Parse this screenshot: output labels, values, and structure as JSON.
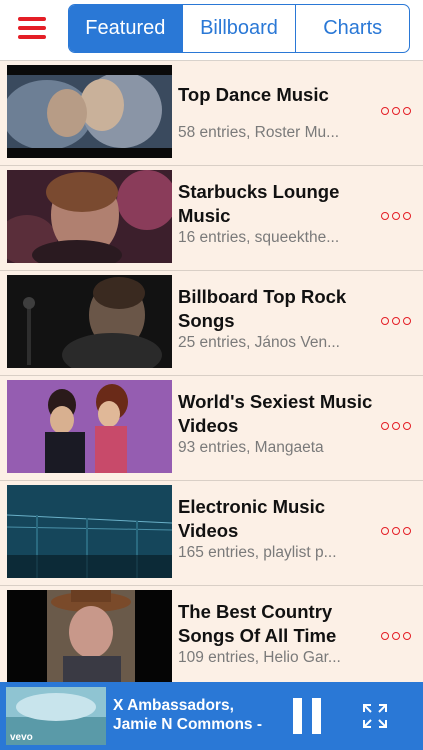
{
  "nav": {
    "menu_icon": "hamburger-icon",
    "tabs": [
      {
        "label": "Featured",
        "active": true
      },
      {
        "label": "Billboard",
        "active": false
      },
      {
        "label": "Charts",
        "active": false
      }
    ]
  },
  "playlists": [
    {
      "title": "Top Dance Music",
      "subtitle": "58 entries, Roster Mu..."
    },
    {
      "title": "Starbucks Lounge Music",
      "subtitle": "16 entries, squeekthe..."
    },
    {
      "title": "Billboard Top Rock Songs",
      "subtitle": "25 entries, János Ven..."
    },
    {
      "title": "World's Sexiest Music Videos",
      "subtitle": "93 entries, Mangaeta"
    },
    {
      "title": "Electronic Music Videos",
      "subtitle": "165 entries, playlist p..."
    },
    {
      "title": "The Best Country Songs Of All Time",
      "subtitle": "109 entries, Helio Gar..."
    }
  ],
  "now_playing": {
    "line1": "X Ambassadors,",
    "line2": "Jamie N Commons -",
    "thumb_caption": "vevo"
  },
  "colors": {
    "accent": "#2a78d6",
    "menu_red": "#e41e26",
    "list_bg": "#fcf0e6"
  }
}
